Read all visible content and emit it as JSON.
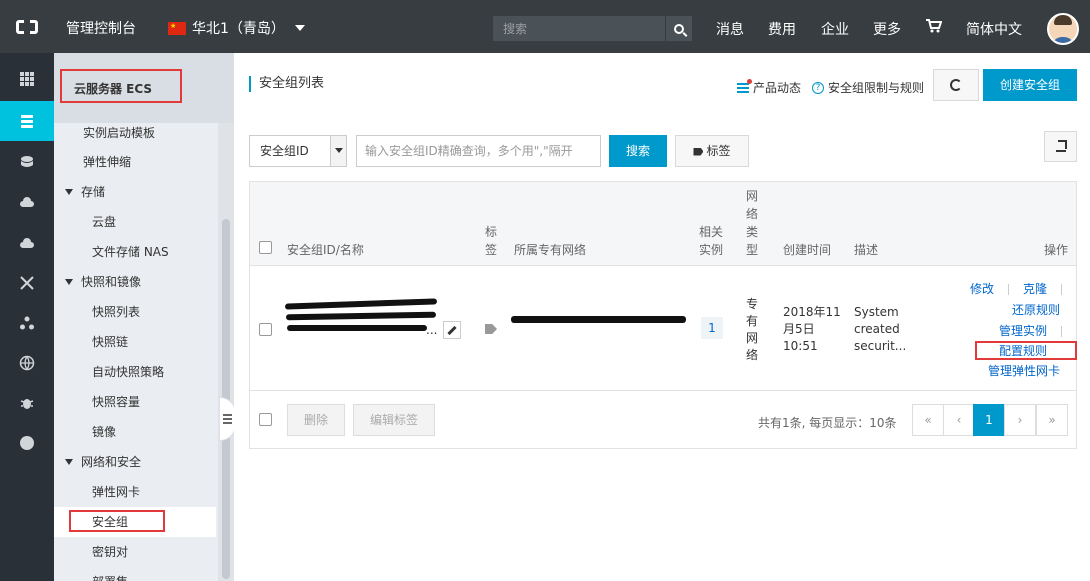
{
  "topbar": {
    "title": "管理控制台",
    "region": "华北1（青岛）",
    "search_placeholder": "搜索",
    "nav": [
      "消息",
      "费用",
      "企业",
      "更多"
    ],
    "language": "简体中文"
  },
  "sidebar": {
    "title": "云服务器 ECS",
    "items": [
      {
        "label": "实例启动模板",
        "type": "item"
      },
      {
        "label": "弹性伸缩",
        "type": "item"
      },
      {
        "label": "存储",
        "type": "group"
      },
      {
        "label": "云盘",
        "type": "sub"
      },
      {
        "label": "文件存储 NAS",
        "type": "sub"
      },
      {
        "label": "快照和镜像",
        "type": "group"
      },
      {
        "label": "快照列表",
        "type": "sub"
      },
      {
        "label": "快照链",
        "type": "sub"
      },
      {
        "label": "自动快照策略",
        "type": "sub"
      },
      {
        "label": "快照容量",
        "type": "sub"
      },
      {
        "label": "镜像",
        "type": "sub"
      },
      {
        "label": "网络和安全",
        "type": "group"
      },
      {
        "label": "弹性网卡",
        "type": "sub"
      },
      {
        "label": "安全组",
        "type": "sub",
        "active": true
      },
      {
        "label": "密钥对",
        "type": "sub"
      },
      {
        "label": "部署集",
        "type": "sub"
      }
    ]
  },
  "header": {
    "page_title": "安全组列表",
    "product_news": "产品动态",
    "limits": "安全组限制与规则",
    "create_button": "创建安全组"
  },
  "filter": {
    "select_value": "安全组ID",
    "input_placeholder": "输入安全组ID精确查询，多个用\",\"隔开",
    "search_button": "搜索",
    "tag_button": "标签"
  },
  "table": {
    "headers": {
      "id_name": "安全组ID/名称",
      "tag": "标签",
      "vpc": "所属专有网络",
      "instances": "相关实例",
      "network_type": "网络类型",
      "created": "创建时间",
      "description": "描述",
      "actions": "操作"
    },
    "rows": [
      {
        "instances": "1",
        "network_type": "专有网络",
        "created": [
          "2018年11",
          "月5日",
          "10:51"
        ],
        "description": [
          "System",
          "created",
          "securit..."
        ],
        "name_suffix": "...",
        "actions": [
          "修改",
          "克隆",
          "还原规则",
          "管理实例",
          "配置规则",
          "管理弹性网卡"
        ]
      }
    ],
    "footer": {
      "delete_button": "删除",
      "edit_tags_button": "编辑标签",
      "summary": "共有1条, 每页显示：10条",
      "pages": [
        "«",
        "‹",
        "1",
        "›",
        "»"
      ]
    }
  }
}
